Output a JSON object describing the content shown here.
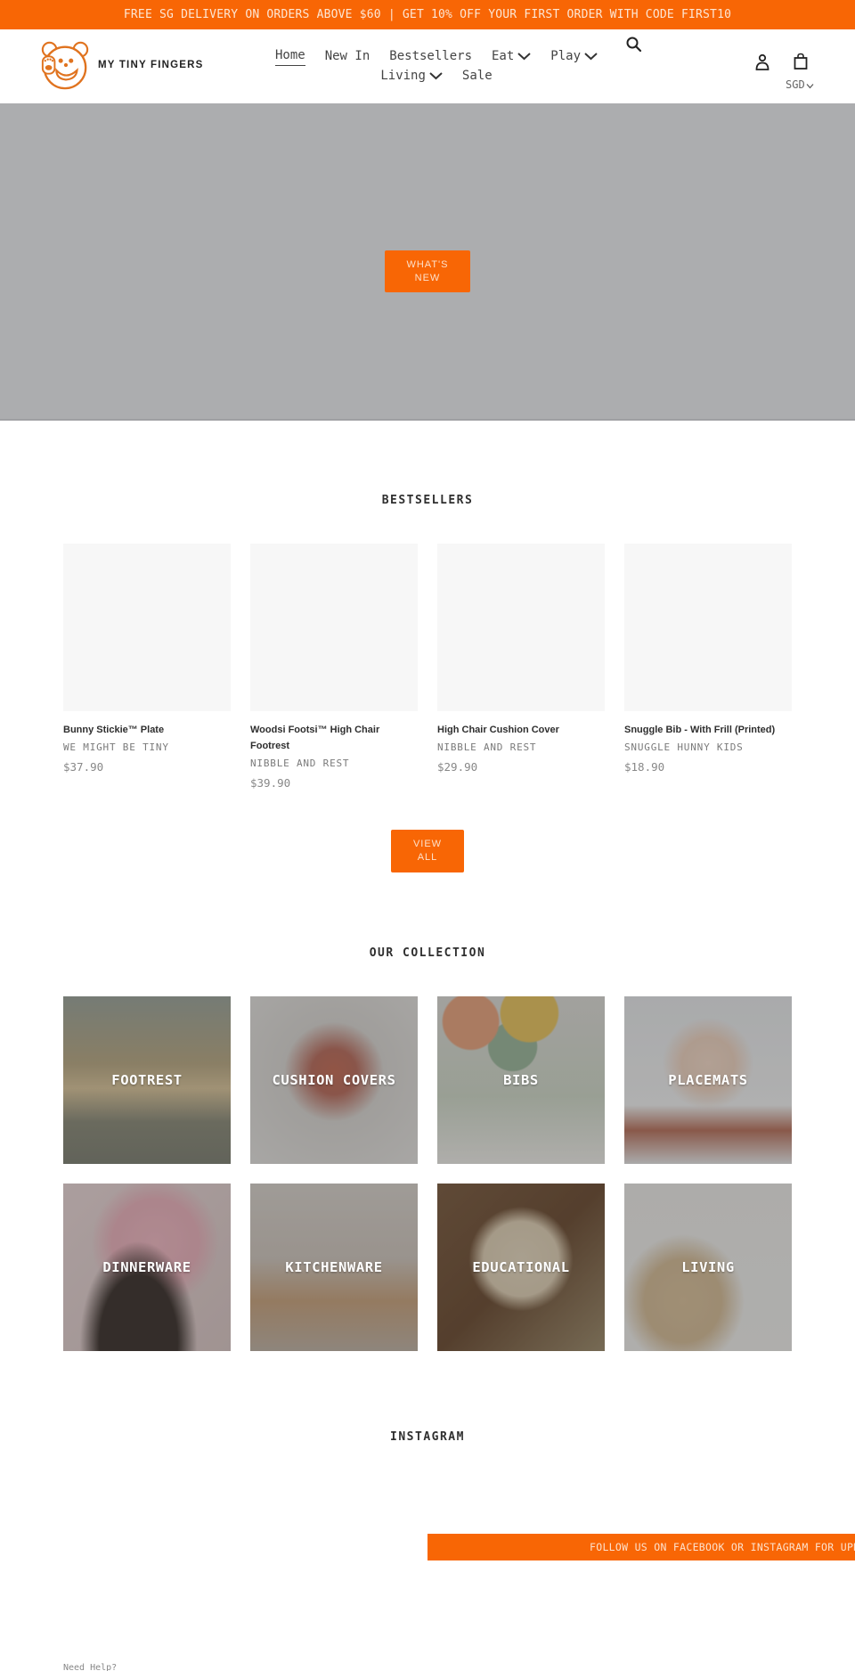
{
  "announcement": "FREE SG DELIVERY ON ORDERS ABOVE $60 | GET 10% OFF YOUR FIRST ORDER WITH CODE FIRST10",
  "brand": {
    "name": "MY TINY FINGERS",
    "logo_icon": "bear-face-logo"
  },
  "colors": {
    "accent": "#f86605",
    "hero_bg": "#acadaf",
    "placeholder": "#f7f7f7"
  },
  "nav": {
    "items": [
      {
        "label": "Home",
        "active": true,
        "dropdown": false
      },
      {
        "label": "New In",
        "active": false,
        "dropdown": false
      },
      {
        "label": "Bestsellers",
        "active": false,
        "dropdown": false
      },
      {
        "label": "Eat",
        "active": false,
        "dropdown": true
      },
      {
        "label": "Play",
        "active": false,
        "dropdown": true
      },
      {
        "label": "Living",
        "active": false,
        "dropdown": true
      },
      {
        "label": "Sale",
        "active": false,
        "dropdown": false
      }
    ]
  },
  "header_icons": {
    "search": "search-icon",
    "account": "account-icon",
    "cart": "cart-icon"
  },
  "currency": {
    "selected": "SGD"
  },
  "hero": {
    "button_label": "WHAT'S NEW"
  },
  "bestsellers": {
    "title": "BESTSELLERS",
    "products": [
      {
        "title": "Bunny Stickie™ Plate",
        "vendor": "WE MIGHT BE TINY",
        "price": "$37.90"
      },
      {
        "title": "Woodsi Footsi™ High Chair Footrest",
        "vendor": "NIBBLE AND REST",
        "price": "$39.90"
      },
      {
        "title": "High Chair Cushion Cover",
        "vendor": "NIBBLE AND REST",
        "price": "$29.90"
      },
      {
        "title": "Snuggle Bib - With Frill (Printed)",
        "vendor": "SNUGGLE HUNNY KIDS",
        "price": "$18.90"
      }
    ],
    "view_all_label": "VIEW ALL"
  },
  "collection": {
    "title": "OUR COLLECTION",
    "items": [
      {
        "label": "FOOTREST"
      },
      {
        "label": "CUSHION COVERS"
      },
      {
        "label": "BIBS"
      },
      {
        "label": "PLACEMATS"
      },
      {
        "label": "DINNERWARE"
      },
      {
        "label": "KITCHENWARE"
      },
      {
        "label": "EDUCATIONAL"
      },
      {
        "label": "LIVING"
      }
    ]
  },
  "instagram": {
    "title": "INSTAGRAM",
    "follow_text": "FOLLOW US ON FACEBOOK OR INSTAGRAM FOR UPDATES"
  },
  "footer": {
    "need_help": "Need Help?"
  }
}
